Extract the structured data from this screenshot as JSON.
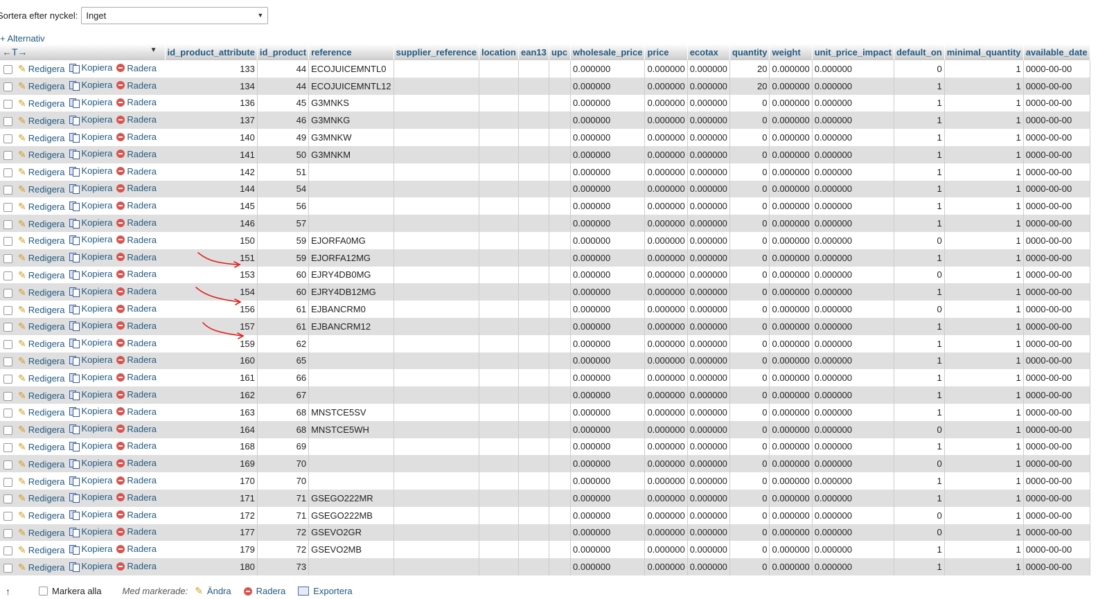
{
  "sort": {
    "label": "Sortera efter nyckel:",
    "selected": "Inget"
  },
  "options_label": "+ Alternativ",
  "table": {
    "nav_arrows": "←T→",
    "columns": [
      "id_product_attribute",
      "id_product",
      "reference",
      "supplier_reference",
      "location",
      "ean13",
      "upc",
      "wholesale_price",
      "price",
      "ecotax",
      "quantity",
      "weight",
      "unit_price_impact",
      "default_on",
      "minimal_quantity",
      "available_date"
    ],
    "action_labels": {
      "edit": "Redigera",
      "copy": "Kopiera",
      "delete": "Radera"
    },
    "rows": [
      [
        "133",
        "44",
        "ECOJUICEMNTL0",
        "",
        "",
        "",
        "",
        "0.000000",
        "0.000000",
        "0.000000",
        "20",
        "0.000000",
        "0.000000",
        "0",
        "1",
        "0000-00-00"
      ],
      [
        "134",
        "44",
        "ECOJUICEMNTL12",
        "",
        "",
        "",
        "",
        "0.000000",
        "0.000000",
        "0.000000",
        "20",
        "0.000000",
        "0.000000",
        "1",
        "1",
        "0000-00-00"
      ],
      [
        "136",
        "45",
        "G3MNKS",
        "",
        "",
        "",
        "",
        "0.000000",
        "0.000000",
        "0.000000",
        "0",
        "0.000000",
        "0.000000",
        "1",
        "1",
        "0000-00-00"
      ],
      [
        "137",
        "46",
        "G3MNKG",
        "",
        "",
        "",
        "",
        "0.000000",
        "0.000000",
        "0.000000",
        "0",
        "0.000000",
        "0.000000",
        "1",
        "1",
        "0000-00-00"
      ],
      [
        "140",
        "49",
        "G3MNKW",
        "",
        "",
        "",
        "",
        "0.000000",
        "0.000000",
        "0.000000",
        "0",
        "0.000000",
        "0.000000",
        "1",
        "1",
        "0000-00-00"
      ],
      [
        "141",
        "50",
        "G3MNKM",
        "",
        "",
        "",
        "",
        "0.000000",
        "0.000000",
        "0.000000",
        "0",
        "0.000000",
        "0.000000",
        "1",
        "1",
        "0000-00-00"
      ],
      [
        "142",
        "51",
        "",
        "",
        "",
        "",
        "",
        "0.000000",
        "0.000000",
        "0.000000",
        "0",
        "0.000000",
        "0.000000",
        "1",
        "1",
        "0000-00-00"
      ],
      [
        "144",
        "54",
        "",
        "",
        "",
        "",
        "",
        "0.000000",
        "0.000000",
        "0.000000",
        "0",
        "0.000000",
        "0.000000",
        "1",
        "1",
        "0000-00-00"
      ],
      [
        "145",
        "56",
        "",
        "",
        "",
        "",
        "",
        "0.000000",
        "0.000000",
        "0.000000",
        "0",
        "0.000000",
        "0.000000",
        "1",
        "1",
        "0000-00-00"
      ],
      [
        "146",
        "57",
        "",
        "",
        "",
        "",
        "",
        "0.000000",
        "0.000000",
        "0.000000",
        "0",
        "0.000000",
        "0.000000",
        "1",
        "1",
        "0000-00-00"
      ],
      [
        "150",
        "59",
        "EJORFA0MG",
        "",
        "",
        "",
        "",
        "0.000000",
        "0.000000",
        "0.000000",
        "0",
        "0.000000",
        "0.000000",
        "0",
        "1",
        "0000-00-00"
      ],
      [
        "151",
        "59",
        "EJORFA12MG",
        "",
        "",
        "",
        "",
        "0.000000",
        "0.000000",
        "0.000000",
        "0",
        "0.000000",
        "0.000000",
        "1",
        "1",
        "0000-00-00"
      ],
      [
        "153",
        "60",
        "EJRY4DB0MG",
        "",
        "",
        "",
        "",
        "0.000000",
        "0.000000",
        "0.000000",
        "0",
        "0.000000",
        "0.000000",
        "0",
        "1",
        "0000-00-00"
      ],
      [
        "154",
        "60",
        "EJRY4DB12MG",
        "",
        "",
        "",
        "",
        "0.000000",
        "0.000000",
        "0.000000",
        "0",
        "0.000000",
        "0.000000",
        "1",
        "1",
        "0000-00-00"
      ],
      [
        "156",
        "61",
        "EJBANCRM0",
        "",
        "",
        "",
        "",
        "0.000000",
        "0.000000",
        "0.000000",
        "0",
        "0.000000",
        "0.000000",
        "0",
        "1",
        "0000-00-00"
      ],
      [
        "157",
        "61",
        "EJBANCRM12",
        "",
        "",
        "",
        "",
        "0.000000",
        "0.000000",
        "0.000000",
        "0",
        "0.000000",
        "0.000000",
        "1",
        "1",
        "0000-00-00"
      ],
      [
        "159",
        "62",
        "",
        "",
        "",
        "",
        "",
        "0.000000",
        "0.000000",
        "0.000000",
        "0",
        "0.000000",
        "0.000000",
        "1",
        "1",
        "0000-00-00"
      ],
      [
        "160",
        "65",
        "",
        "",
        "",
        "",
        "",
        "0.000000",
        "0.000000",
        "0.000000",
        "0",
        "0.000000",
        "0.000000",
        "1",
        "1",
        "0000-00-00"
      ],
      [
        "161",
        "66",
        "",
        "",
        "",
        "",
        "",
        "0.000000",
        "0.000000",
        "0.000000",
        "0",
        "0.000000",
        "0.000000",
        "1",
        "1",
        "0000-00-00"
      ],
      [
        "162",
        "67",
        "",
        "",
        "",
        "",
        "",
        "0.000000",
        "0.000000",
        "0.000000",
        "0",
        "0.000000",
        "0.000000",
        "1",
        "1",
        "0000-00-00"
      ],
      [
        "163",
        "68",
        "MNSTCE5SV",
        "",
        "",
        "",
        "",
        "0.000000",
        "0.000000",
        "0.000000",
        "0",
        "0.000000",
        "0.000000",
        "1",
        "1",
        "0000-00-00"
      ],
      [
        "164",
        "68",
        "MNSTCE5WH",
        "",
        "",
        "",
        "",
        "0.000000",
        "0.000000",
        "0.000000",
        "0",
        "0.000000",
        "0.000000",
        "0",
        "1",
        "0000-00-00"
      ],
      [
        "168",
        "69",
        "",
        "",
        "",
        "",
        "",
        "0.000000",
        "0.000000",
        "0.000000",
        "0",
        "0.000000",
        "0.000000",
        "1",
        "1",
        "0000-00-00"
      ],
      [
        "169",
        "70",
        "",
        "",
        "",
        "",
        "",
        "0.000000",
        "0.000000",
        "0.000000",
        "0",
        "0.000000",
        "0.000000",
        "0",
        "1",
        "0000-00-00"
      ],
      [
        "170",
        "70",
        "",
        "",
        "",
        "",
        "",
        "0.000000",
        "0.000000",
        "0.000000",
        "0",
        "0.000000",
        "0.000000",
        "1",
        "1",
        "0000-00-00"
      ],
      [
        "171",
        "71",
        "GSEGO222MR",
        "",
        "",
        "",
        "",
        "0.000000",
        "0.000000",
        "0.000000",
        "0",
        "0.000000",
        "0.000000",
        "1",
        "1",
        "0000-00-00"
      ],
      [
        "172",
        "71",
        "GSEGO222MB",
        "",
        "",
        "",
        "",
        "0.000000",
        "0.000000",
        "0.000000",
        "0",
        "0.000000",
        "0.000000",
        "0",
        "1",
        "0000-00-00"
      ],
      [
        "177",
        "72",
        "GSEVO2GR",
        "",
        "",
        "",
        "",
        "0.000000",
        "0.000000",
        "0.000000",
        "0",
        "0.000000",
        "0.000000",
        "0",
        "1",
        "0000-00-00"
      ],
      [
        "179",
        "72",
        "GSEVO2MB",
        "",
        "",
        "",
        "",
        "0.000000",
        "0.000000",
        "0.000000",
        "0",
        "0.000000",
        "0.000000",
        "1",
        "1",
        "0000-00-00"
      ],
      [
        "180",
        "73",
        "",
        "",
        "",
        "",
        "",
        "0.000000",
        "0.000000",
        "0.000000",
        "0",
        "0.000000",
        "0.000000",
        "1",
        "1",
        "0000-00-00"
      ]
    ]
  },
  "footer": {
    "check_all": "Markera alla",
    "with_selected": "Med markerade:",
    "change": "Ändra",
    "delete": "Radera",
    "export": "Exportera"
  },
  "colors": {
    "link": "#235a81",
    "row_alt": "#dfdfdf",
    "annotation": "#e0201a"
  }
}
